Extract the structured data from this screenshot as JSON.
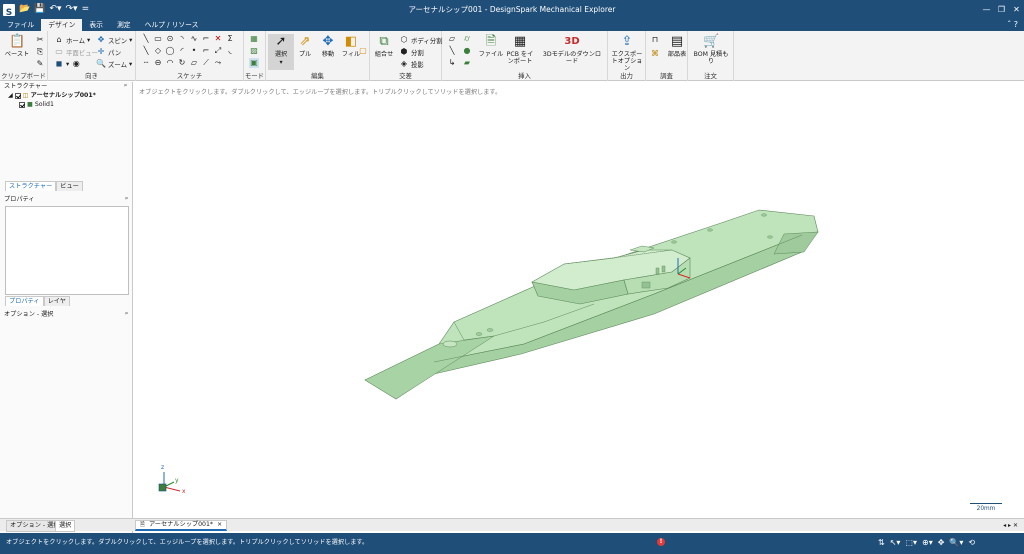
{
  "window": {
    "title": "アーセナルシップ001 - DesignSpark Mechanical Explorer",
    "logo": "S",
    "quick_access_icons": [
      "folder-open-icon",
      "save-icon",
      "undo-icon",
      "redo-icon",
      "customize-icon"
    ],
    "controls": [
      "minimize-icon",
      "restore-icon",
      "close-icon"
    ]
  },
  "menu": {
    "tabs": [
      "ファイル",
      "デザイン",
      "表示",
      "測定",
      "ヘルプ / リソース"
    ],
    "active_tab": "デザイン"
  },
  "ribbon": {
    "clipboard": {
      "label": "クリップボード",
      "paste": "ペースト"
    },
    "orient": {
      "label": "向き",
      "home": "ホーム",
      "plane_view": "平面ビュー",
      "spin": "スピン",
      "pan": "パン",
      "zoom": "ズーム"
    },
    "sketch": {
      "label": "スケッチ"
    },
    "mode": {
      "label": "モード"
    },
    "edit": {
      "label": "編集",
      "select": "選択",
      "pull": "プル",
      "move": "移動",
      "fill": "フィル"
    },
    "intersect": {
      "label": "交差",
      "combine": "組合せ",
      "split_body": "ボディ分割",
      "split": "分割",
      "project": "投影"
    },
    "insert": {
      "label": "挿入",
      "file": "ファイル",
      "pcb_import": "PCB をインポート",
      "download_3d": "3Dモデルのダウンロード"
    },
    "output": {
      "label": "出力",
      "export_options": "エクスポートオプション"
    },
    "investigate": {
      "label": "調査",
      "parts_list": "部品表"
    },
    "order": {
      "label": "注文",
      "bom_quote": "BOM 見積もり"
    }
  },
  "left_panel": {
    "structure_header": "ストラクチャー",
    "tree": [
      {
        "label": "アーセナルシップ001*",
        "bold": true
      },
      {
        "label": "Solid1",
        "bold": false
      }
    ],
    "structure_tabs": [
      "ストラクチャー",
      "ビュー"
    ],
    "properties_header": "プロパティ",
    "properties_tabs": [
      "プロパティ",
      "レイヤ"
    ],
    "options_header": "オプション - 選択"
  },
  "viewport": {
    "hint": "オブジェクトをクリックします。ダブルクリックして、エッジループを選択します。トリプルクリックしてソリッドを選択します。",
    "scale_label": "20mm",
    "model_color": "#b3dcb0",
    "axis": {
      "x": "x",
      "y": "y",
      "z": "z"
    }
  },
  "doc_bar": {
    "bottom_tabs": [
      "オプション - 選択",
      "選択"
    ],
    "document_tab": "アーセナルシップ001*"
  },
  "status": {
    "message": "オブジェクトをクリックします。ダブルクリックして、エッジループを選択します。トリプルクリックしてソリッドを選択します。",
    "warning_count": "!"
  }
}
